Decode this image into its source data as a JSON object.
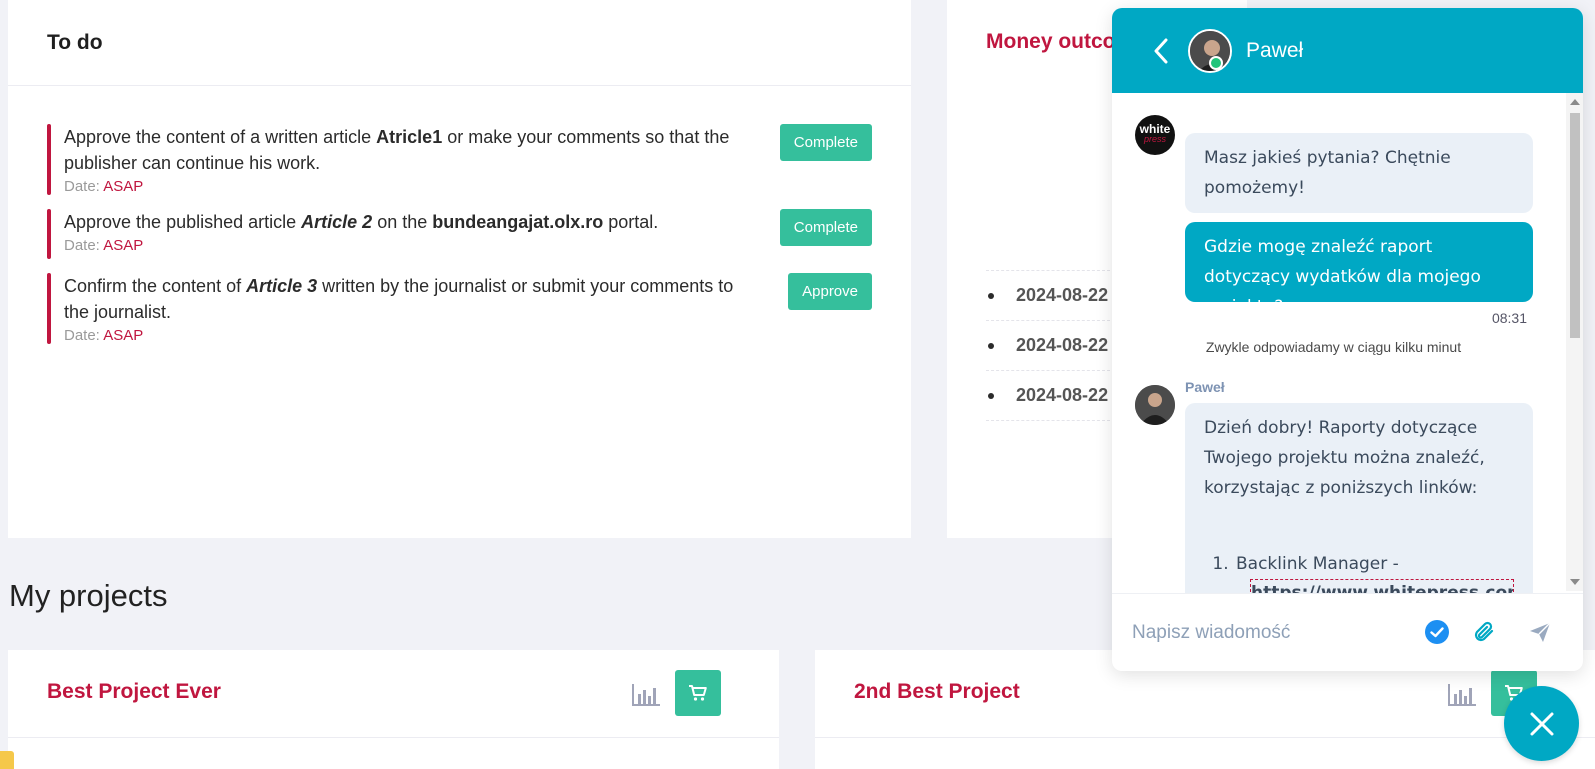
{
  "todo": {
    "title": "To do",
    "items": [
      {
        "parts": [
          "Approve the content of a written article ",
          "Atricle1",
          " or make your comments so that the publisher can continue his work."
        ],
        "date_label": "Date: ",
        "date_value": "ASAP",
        "button": "Complete"
      },
      {
        "parts": [
          "Approve the published article ",
          "Article 2",
          " on the ",
          "bundeangajat.olx.ro",
          " portal."
        ],
        "date_label": "Date: ",
        "date_value": "ASAP",
        "button": "Complete"
      },
      {
        "parts": [
          "Confirm the content of ",
          "Article 3",
          " written by the journalist or submit your comments to the journalist."
        ],
        "date_label": "Date: ",
        "date_value": "ASAP",
        "button": "Approve"
      }
    ]
  },
  "money": {
    "title": "Money outco",
    "rows": [
      "2024-08-22",
      "2024-08-22",
      "2024-08-22"
    ]
  },
  "projects": {
    "section_title": "My projects",
    "cards": [
      {
        "title": "Best Project Ever"
      },
      {
        "title": "2nd Best Project"
      }
    ]
  },
  "chat": {
    "agent_name": "Paweł",
    "logo_line1": "white",
    "logo_line2": "press",
    "msg_in_1": "Masz jakieś pytania? Chętnie pomożemy!",
    "msg_out_1": "Gdzie mogę znaleźć raport dotyczący wydatków dla mojego projektu?",
    "time_1": "08:31",
    "reply_note": "Zwykle odpowiadamy w ciągu kilku minut",
    "agent_label": "Paweł",
    "msg_in_2": "Dzień dobry! Raporty dotyczące Twojego projektu można znaleźć, korzystając z poniższych linków:",
    "list_item_1": "Backlink Manager -",
    "list_link_1": "https://www.whitepress.com/pa",
    "input_placeholder": "Napisz wiadomość"
  },
  "colors": {
    "accent_red": "#c0163f",
    "accent_green": "#35bf9c",
    "chat_teal": "#00a8c4"
  }
}
